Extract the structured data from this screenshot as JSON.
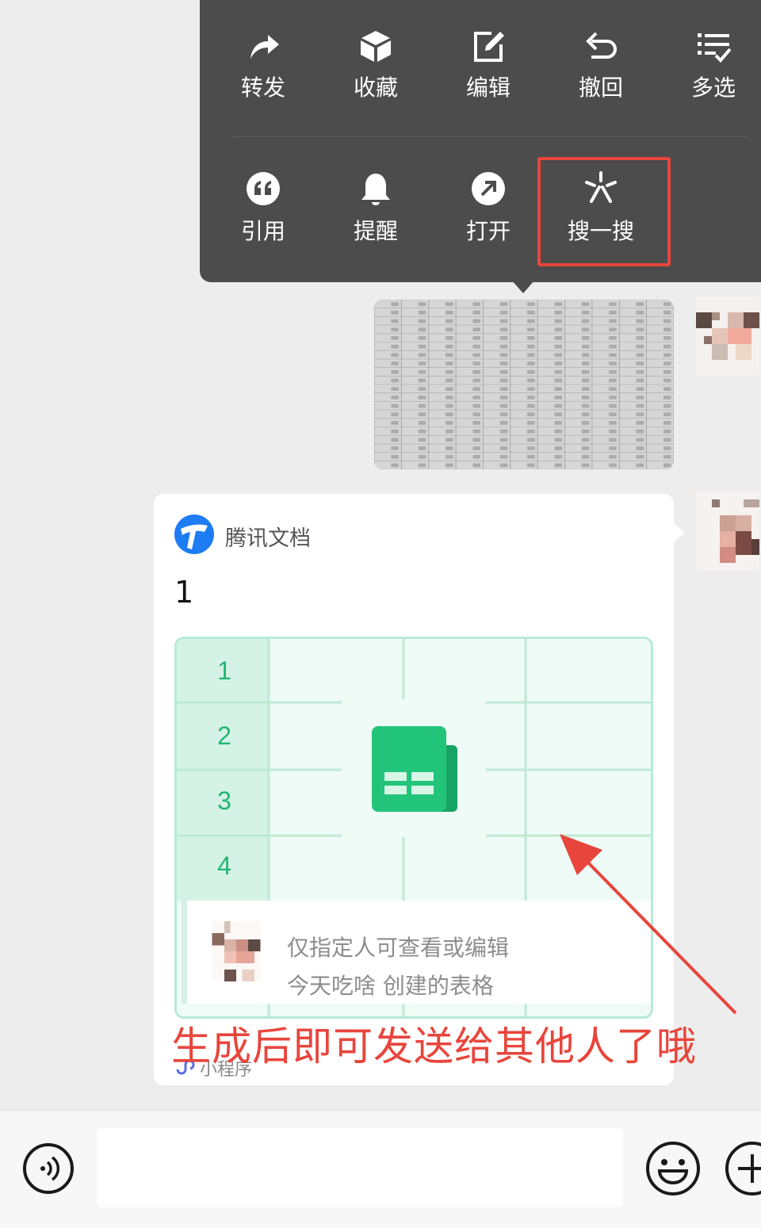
{
  "menu": {
    "row1": [
      {
        "label": "转发",
        "icon": "forward-icon"
      },
      {
        "label": "收藏",
        "icon": "favorite-cube-icon"
      },
      {
        "label": "编辑",
        "icon": "edit-icon"
      },
      {
        "label": "撤回",
        "icon": "recall-icon"
      },
      {
        "label": "多选",
        "icon": "multi-select-icon"
      }
    ],
    "row2": [
      {
        "label": "引用",
        "icon": "quote-icon"
      },
      {
        "label": "提醒",
        "icon": "bell-icon"
      },
      {
        "label": "打开",
        "icon": "open-arrow-icon"
      },
      {
        "label": "搜一搜",
        "icon": "search-sparkle-icon"
      }
    ],
    "highlight_color": "#e8453c"
  },
  "card": {
    "app_name": "腾讯文档",
    "title": "1",
    "row_numbers": [
      "1",
      "2",
      "3",
      "4"
    ],
    "owner_line1": "仅指定人可查看或编辑",
    "owner_line2": "今天吃啥 创建的表格",
    "footer_label": "小程序"
  },
  "annotation": {
    "text": "生成后即可发送给其他人了哦",
    "color": "#e8453c"
  },
  "colors": {
    "menu_bg": "#4c4c4c",
    "accent_green": "#22b573",
    "brand_blue": "#1e7cf2"
  }
}
